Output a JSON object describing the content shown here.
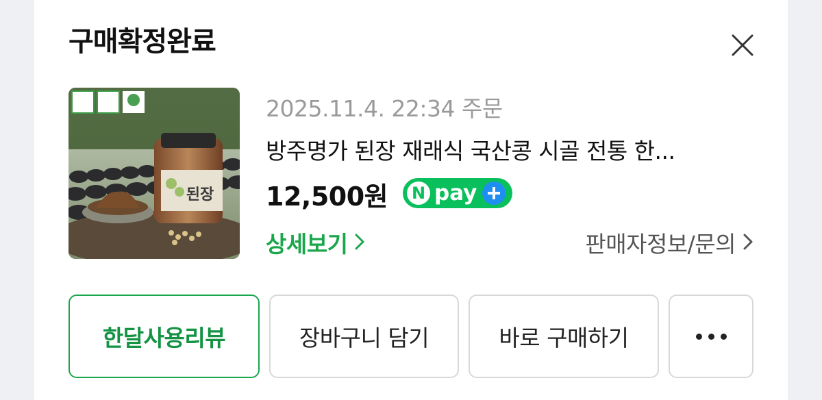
{
  "dialog": {
    "title": "구매확정완료"
  },
  "order": {
    "date": "2025.11.4. 22:34 주문",
    "product_name": "방주명가 된장 재래식 국산콩 시골 전통 한...",
    "price": "12,500원",
    "npay_label": "pay",
    "npay_n": "N",
    "detail_link": "상세보기",
    "seller_link": "판매자정보/문의",
    "thumbnail": {
      "jar_label": "된장"
    }
  },
  "actions": {
    "review": "한달사용리뷰",
    "cart": "장바구니 담기",
    "buy_now": "바로 구매하기"
  },
  "colors": {
    "accent": "#1aa64b",
    "npay": "#0ac05c",
    "plus": "#1e8ef0"
  }
}
